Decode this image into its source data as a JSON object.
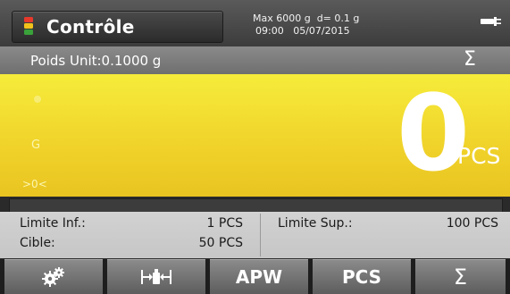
{
  "header": {
    "mode_title": "Contrôle",
    "capacity": "Max 6000 g  d= 0.1 g",
    "datetime": "09:00   05/07/2015",
    "mode_icon": "checkweigh-traffic-light-icon",
    "power_icon": "ac-power-icon"
  },
  "info": {
    "unit_weight": "Poids Unit:0.1000 g",
    "accumulation_symbol": "Σ"
  },
  "display": {
    "value": "0",
    "unit": "PCS",
    "gross_indicator": "G",
    "zero_indicator": ">0<",
    "progress_fraction": 0
  },
  "limits": {
    "lower_label": "Limite Inf.:",
    "lower_value": "1 PCS",
    "upper_label": "Limite Sup.:",
    "upper_value": "100 PCS",
    "target_label": "Cible:",
    "target_value": "50 PCS"
  },
  "softkeys": {
    "settings_icon": "gears-icon",
    "tare_icon": "tare-icon",
    "apw_label": "APW",
    "pcs_label": "PCS",
    "sum_label": "Σ"
  },
  "colors": {
    "display_yellow": "#f0d22a",
    "light_red": "#e8392b",
    "light_yellow": "#f2c21b",
    "light_green": "#3aa23a"
  }
}
